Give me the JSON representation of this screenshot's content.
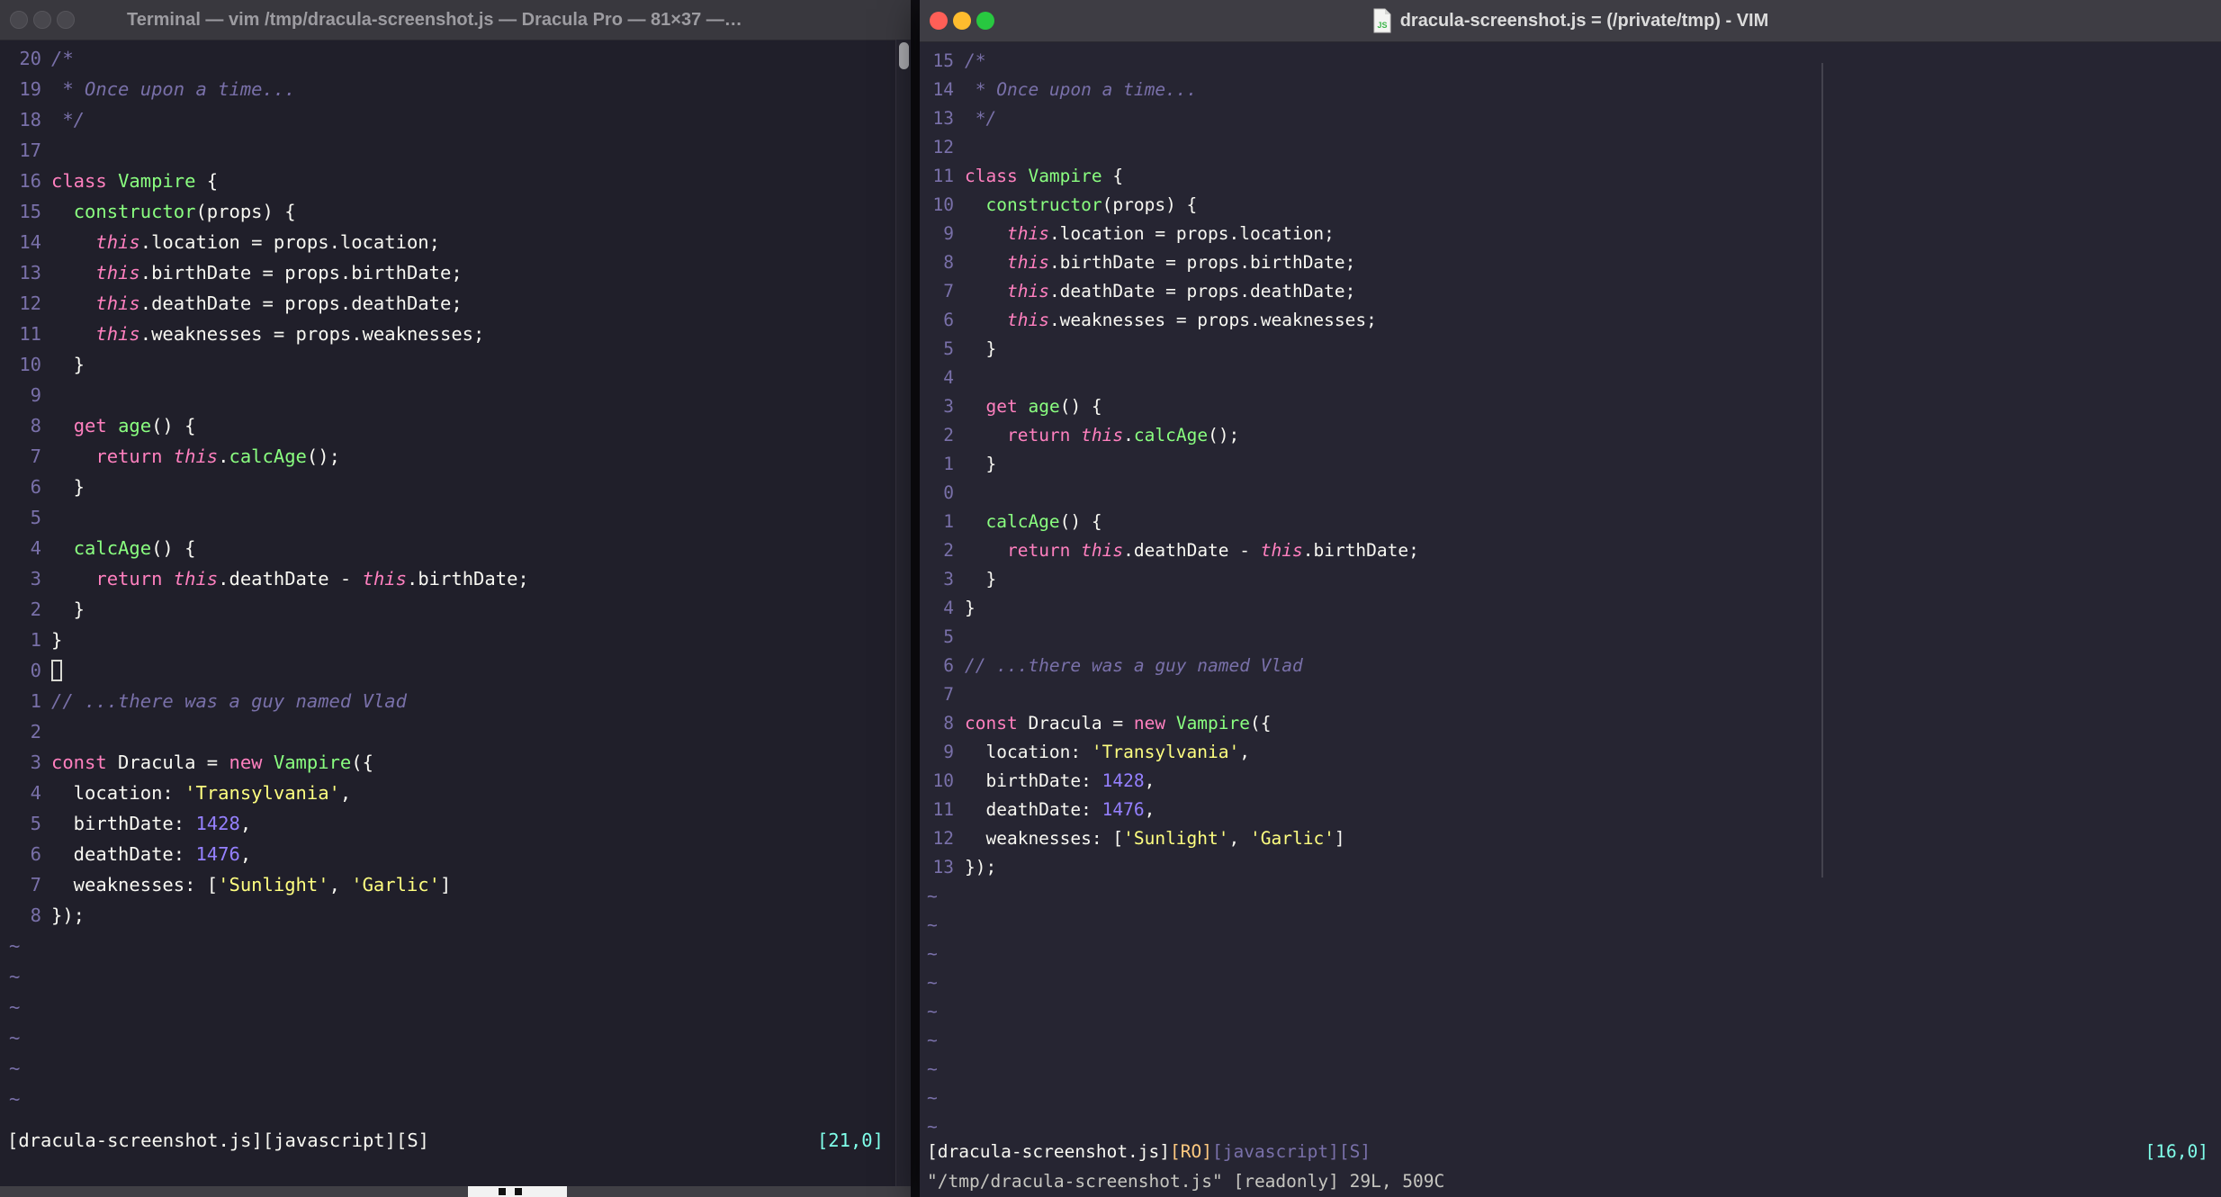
{
  "theme": {
    "terminal_background": "#201F2A",
    "gui_background": "#262532",
    "foreground": "#F8F8F2",
    "comment": "#7970A9",
    "keyword_pink": "#FF80BF",
    "function_green": "#8AFF80",
    "string_yellow": "#FFFF80",
    "number_purple": "#9580FF",
    "cyan": "#80FFEA",
    "orange": "#FFCA80",
    "line_number": "#7970A9",
    "traffic_red": "#FF5F57",
    "traffic_yellow": "#FEBC2E",
    "traffic_green": "#28C840"
  },
  "left_window": {
    "title": "Terminal — vim /tmp/dracula-screenshot.js — Dracula Pro — 81×37 —…",
    "cursor_line_index": 20,
    "cursor_style": "hollow",
    "rel_nums": [
      "20",
      "19",
      "18",
      "17",
      "16",
      "15",
      "14",
      "13",
      "12",
      "11",
      "10",
      "9",
      "8",
      "7",
      "6",
      "5",
      "4",
      "3",
      "2",
      "1",
      "0",
      "1",
      "2",
      "3",
      "4",
      "5",
      "6",
      "7",
      "8"
    ],
    "tilde_count": 6,
    "status_segments": [
      [
        "[dracula-screenshot.js]",
        "f"
      ],
      [
        "[javascript]",
        "f"
      ],
      [
        "[S]",
        "f"
      ]
    ],
    "status_right": "[21,0]",
    "command_line": ""
  },
  "right_window": {
    "title": "dracula-screenshot.js = (/private/tmp) - VIM",
    "cursor_line_index": 15,
    "cursor_style": "none",
    "rel_nums": [
      "15",
      "14",
      "13",
      "12",
      "11",
      "10",
      "9",
      "8",
      "7",
      "6",
      "5",
      "4",
      "3",
      "2",
      "1",
      "0",
      "1",
      "2",
      "3",
      "4",
      "5",
      "6",
      "7",
      "8",
      "9",
      "10",
      "11",
      "12",
      "13"
    ],
    "tilde_count": 9,
    "status_segments": [
      [
        "[dracula-screenshot.js]",
        "f"
      ],
      [
        "[RO]",
        "o"
      ],
      [
        "[javascript]",
        "c2"
      ],
      [
        "[S]",
        "c2"
      ]
    ],
    "status_right": "[16,0]",
    "command_line": "\"/tmp/dracula-screenshot.js\" [readonly] 29L, 509C"
  },
  "code_lines": [
    [
      [
        "/*",
        "c"
      ]
    ],
    [
      [
        " * Once upon a time...",
        "c"
      ]
    ],
    [
      [
        " */",
        "c"
      ]
    ],
    [],
    [
      [
        "class",
        "k"
      ],
      [
        " ",
        "f"
      ],
      [
        "Vampire",
        "g"
      ],
      [
        " {",
        "f"
      ]
    ],
    [
      [
        "  ",
        "f"
      ],
      [
        "constructor",
        "g"
      ],
      [
        "(props) {",
        "f"
      ]
    ],
    [
      [
        "    ",
        "f"
      ],
      [
        "this",
        "t"
      ],
      [
        ".location = props.location;",
        "f"
      ]
    ],
    [
      [
        "    ",
        "f"
      ],
      [
        "this",
        "t"
      ],
      [
        ".birthDate = props.birthDate;",
        "f"
      ]
    ],
    [
      [
        "    ",
        "f"
      ],
      [
        "this",
        "t"
      ],
      [
        ".deathDate = props.deathDate;",
        "f"
      ]
    ],
    [
      [
        "    ",
        "f"
      ],
      [
        "this",
        "t"
      ],
      [
        ".weaknesses = props.weaknesses;",
        "f"
      ]
    ],
    [
      [
        "  }",
        "f"
      ]
    ],
    [],
    [
      [
        "  ",
        "f"
      ],
      [
        "get",
        "k"
      ],
      [
        " ",
        "f"
      ],
      [
        "age",
        "g"
      ],
      [
        "() {",
        "f"
      ]
    ],
    [
      [
        "    ",
        "f"
      ],
      [
        "return",
        "k"
      ],
      [
        " ",
        "f"
      ],
      [
        "this",
        "t"
      ],
      [
        ".",
        "f"
      ],
      [
        "calcAge",
        "g"
      ],
      [
        "();",
        "f"
      ]
    ],
    [
      [
        "  }",
        "f"
      ]
    ],
    [],
    [
      [
        "  ",
        "f"
      ],
      [
        "calcAge",
        "g"
      ],
      [
        "() {",
        "f"
      ]
    ],
    [
      [
        "    ",
        "f"
      ],
      [
        "return",
        "k"
      ],
      [
        " ",
        "f"
      ],
      [
        "this",
        "t"
      ],
      [
        ".deathDate - ",
        "f"
      ],
      [
        "this",
        "t"
      ],
      [
        ".birthDate;",
        "f"
      ]
    ],
    [
      [
        "  }",
        "f"
      ]
    ],
    [
      [
        "}",
        "f"
      ]
    ],
    [],
    [
      [
        "// ...there was a guy named Vlad",
        "c"
      ]
    ],
    [],
    [
      [
        "const",
        "k"
      ],
      [
        " Dracula = ",
        "f"
      ],
      [
        "new",
        "k"
      ],
      [
        " ",
        "f"
      ],
      [
        "Vampire",
        "g"
      ],
      [
        "({",
        "f"
      ]
    ],
    [
      [
        "  location: ",
        "f"
      ],
      [
        "'Transylvania'",
        "s"
      ],
      [
        ",",
        "f"
      ]
    ],
    [
      [
        "  birthDate: ",
        "f"
      ],
      [
        "1428",
        "n"
      ],
      [
        ",",
        "f"
      ]
    ],
    [
      [
        "  deathDate: ",
        "f"
      ],
      [
        "1476",
        "n"
      ],
      [
        ",",
        "f"
      ]
    ],
    [
      [
        "  weaknesses: [",
        "f"
      ],
      [
        "'Sunlight'",
        "s"
      ],
      [
        ", ",
        "f"
      ],
      [
        "'Garlic'",
        "s"
      ],
      [
        "]",
        "f"
      ]
    ],
    [
      [
        "});",
        "f"
      ]
    ]
  ]
}
